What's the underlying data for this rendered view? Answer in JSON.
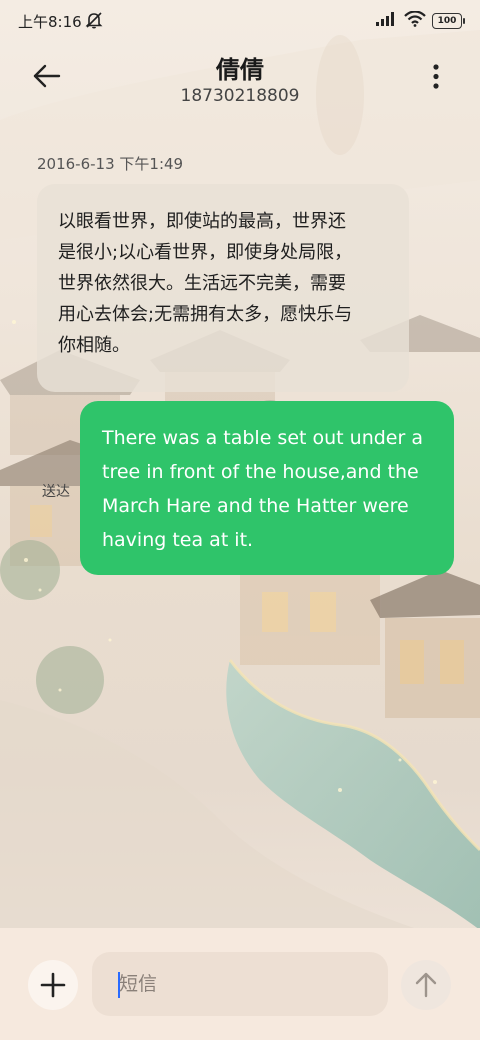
{
  "status_bar": {
    "time": "上午8:16",
    "battery": "100"
  },
  "header": {
    "contact_name": "倩倩",
    "phone_number": "18730218809"
  },
  "conversation": {
    "timestamp": "2016-6-13 下午1:49",
    "incoming_lines": [
      "以眼看世界，即使站的最高，世界还",
      "是很小;以心看世界，即使身处局限，",
      "世界依然很大。生活远不完美，需要",
      "用心去体会;无需拥有太多，愿快乐与",
      "你相随。"
    ],
    "outgoing_lines": [
      "There was a table set out under a",
      "tree in front of the house,and the",
      "March Hare and the Hatter were",
      "having tea at it."
    ],
    "sent_status": "送达"
  },
  "composer": {
    "placeholder": "短信"
  },
  "colors": {
    "outgoing_bubble": "#2fc46a",
    "incoming_bubble": "#e8e0d6",
    "caret": "#2a6bff"
  }
}
